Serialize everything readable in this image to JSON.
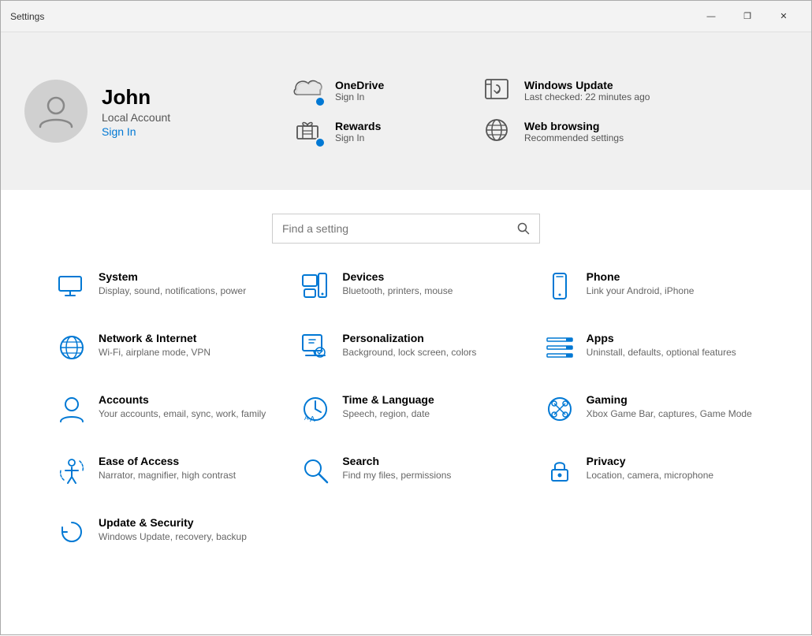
{
  "titlebar": {
    "title": "Settings",
    "minimize": "—",
    "maximize": "❐",
    "close": "✕"
  },
  "account": {
    "name": "John",
    "type": "Local Account",
    "signin_label": "Sign In",
    "avatar_alt": "User avatar"
  },
  "services": [
    {
      "id": "onedrive",
      "name": "OneDrive",
      "sub": "Sign In",
      "has_dot": true
    },
    {
      "id": "windows-update",
      "name": "Windows Update",
      "sub": "Last checked: 22 minutes ago",
      "has_dot": false
    },
    {
      "id": "rewards",
      "name": "Rewards",
      "sub": "Sign In",
      "has_dot": true
    },
    {
      "id": "web-browsing",
      "name": "Web browsing",
      "sub": "Recommended settings",
      "has_dot": false
    }
  ],
  "search": {
    "placeholder": "Find a setting"
  },
  "settings": [
    {
      "id": "system",
      "title": "System",
      "desc": "Display, sound, notifications, power"
    },
    {
      "id": "devices",
      "title": "Devices",
      "desc": "Bluetooth, printers, mouse"
    },
    {
      "id": "phone",
      "title": "Phone",
      "desc": "Link your Android, iPhone"
    },
    {
      "id": "network",
      "title": "Network & Internet",
      "desc": "Wi-Fi, airplane mode, VPN"
    },
    {
      "id": "personalization",
      "title": "Personalization",
      "desc": "Background, lock screen, colors"
    },
    {
      "id": "apps",
      "title": "Apps",
      "desc": "Uninstall, defaults, optional features"
    },
    {
      "id": "accounts",
      "title": "Accounts",
      "desc": "Your accounts, email, sync, work, family"
    },
    {
      "id": "time",
      "title": "Time & Language",
      "desc": "Speech, region, date"
    },
    {
      "id": "gaming",
      "title": "Gaming",
      "desc": "Xbox Game Bar, captures, Game Mode"
    },
    {
      "id": "ease",
      "title": "Ease of Access",
      "desc": "Narrator, magnifier, high contrast"
    },
    {
      "id": "search",
      "title": "Search",
      "desc": "Find my files, permissions"
    },
    {
      "id": "privacy",
      "title": "Privacy",
      "desc": "Location, camera, microphone"
    },
    {
      "id": "update",
      "title": "Update & Security",
      "desc": "Windows Update, recovery, backup"
    }
  ]
}
